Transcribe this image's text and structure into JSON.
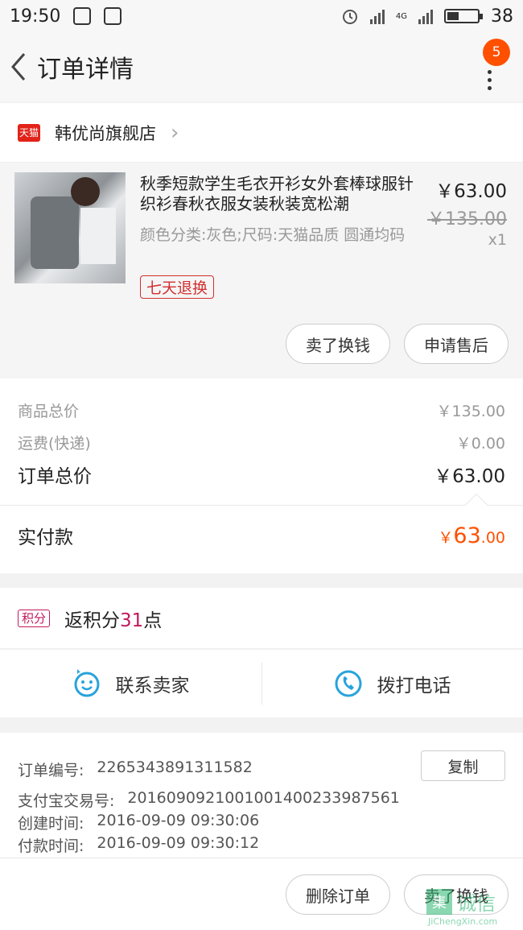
{
  "status": {
    "time": "19:50",
    "battery": "38",
    "network": "4G",
    "battery_level": 0.38
  },
  "nav": {
    "title": "订单详情",
    "badge": "5"
  },
  "store": {
    "name": "韩优尚旗舰店",
    "badge": "天猫"
  },
  "product": {
    "title": "秋季短款学生毛衣开衫女外套棒球服针织衫春秋衣服女装秋装宽松潮",
    "spec": "颜色分类:灰色;尺码:天猫品质 圆通均码",
    "tag": "七天退换",
    "price": "￥63.00",
    "original_price": "￥135.00",
    "qty": "x1",
    "btn_resell": "卖了换钱",
    "btn_aftersale": "申请售后"
  },
  "summary": {
    "goods_total_label": "商品总价",
    "goods_total": "￥135.00",
    "shipping_label": "运费(快递)",
    "shipping": "￥0.00",
    "order_total_label": "订单总价",
    "order_total": "￥63.00",
    "paid_label": "实付款",
    "paid_yen": "￥",
    "paid_int": "63",
    "paid_dec": ".00"
  },
  "points": {
    "badge": "积分",
    "prefix": "返积分",
    "num": "31",
    "suffix": "点"
  },
  "contact": {
    "seller": "联系卖家",
    "phone": "拨打电话"
  },
  "info": {
    "order_no_label": "订单编号:",
    "order_no": "2265343891311582",
    "alipay_label": "支付宝交易号:",
    "alipay": "2016090921001001400233987561",
    "created_label": "创建时间:",
    "created": "2016-09-09 09:30:06",
    "paid_label": "付款时间:",
    "paid": "2016-09-09 09:30:12",
    "copy": "复制"
  },
  "bottom": {
    "delete": "删除订单",
    "resell": "卖了换钱"
  },
  "watermark": {
    "mark": "集",
    "text": "诚信",
    "sub": "JiChengXin.com"
  },
  "colors": {
    "accent": "#ff5000",
    "tmall_red": "#e2231a",
    "tag_red": "#d32f2f",
    "points_pink": "#c2185b",
    "icon_blue": "#29a3dc"
  }
}
